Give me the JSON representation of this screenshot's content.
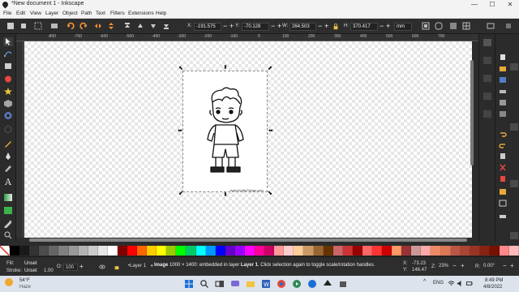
{
  "window": {
    "title": "*New document 1 - Inkscape",
    "controls": [
      "—",
      "☐",
      "✕"
    ]
  },
  "menu": [
    "File",
    "Edit",
    "View",
    "Layer",
    "Object",
    "Path",
    "Text",
    "Filters",
    "Extensions",
    "Help"
  ],
  "toolbar": {
    "x_label": "X:",
    "x_value": "-191.575",
    "y_label": "Y:",
    "y_value": "-70.128",
    "w_label": "W:",
    "w_value": "264.503",
    "h_label": "H:",
    "h_value": "370.417",
    "unit": "mm"
  },
  "ruler": {
    "ticks": [
      "-800",
      "-700",
      "-600",
      "-500",
      "-400",
      "-300",
      "-200",
      "-100",
      "0",
      "100",
      "200",
      "300",
      "400",
      "500",
      "600",
      "700"
    ]
  },
  "canvas": {
    "watermark_text": "www.KraftyThings.com"
  },
  "palette": {
    "colors": [
      "#000000",
      "#1a1a1a",
      "#333333",
      "#4d4d4d",
      "#666666",
      "#808080",
      "#999999",
      "#b3b3b3",
      "#cccccc",
      "#e6e6e6",
      "#ffffff",
      "#800000",
      "#ff0000",
      "#ff6600",
      "#ffcc00",
      "#ffff00",
      "#99cc00",
      "#00ff00",
      "#00cc66",
      "#00ffff",
      "#0099ff",
      "#0000ff",
      "#6600cc",
      "#9900ff",
      "#ff00ff",
      "#ff0099",
      "#cc0066",
      "#ff9999",
      "#ffcccc",
      "#ffcc99",
      "#cc9966",
      "#996633",
      "#663300",
      "#cc6666",
      "#cc3333",
      "#990000",
      "#ff6666",
      "#ff3333",
      "#cc0000",
      "#ff9966",
      "#993333",
      "#cc9999",
      "#ffaaaa",
      "#ee8866",
      "#dd7755",
      "#bb5544",
      "#aa4433",
      "#993322",
      "#882211",
      "#771100",
      "#ff8888",
      "#ffbbbb"
    ]
  },
  "status": {
    "fill_label": "Fill:",
    "fill_value": "Unset",
    "stroke_label": "Stroke:",
    "stroke_value": "Unset",
    "stroke_width": "1.00",
    "opacity_label": "O:",
    "opacity_value": "100",
    "layer": "•Layer 1",
    "message_bold": "Image",
    "message": " 1000 × 1400: embedded in layer ",
    "message_layer": "Layer 1",
    "message_tail": ". Click selection again to toggle scale/rotation handles.",
    "x_label": "X:",
    "x_value": "-73.23",
    "y_label": "Y:",
    "y_value": "146.47",
    "z_label": "Z:",
    "zoom": "23%",
    "r_label": "R:",
    "rotation": "0.00°"
  },
  "taskbar": {
    "weather_temp": "54°F",
    "weather_desc": "Haze",
    "lang": "ENG",
    "time": "8:49 PM",
    "date": "4/8/2022"
  }
}
